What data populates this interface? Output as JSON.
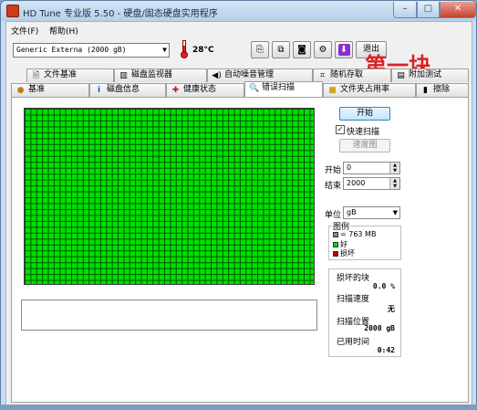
{
  "window": {
    "title": "HD Tune 专业版 5.50 - 硬盘/固态硬盘实用程序"
  },
  "menu": {
    "file": "文件(F)",
    "help": "帮助(H)"
  },
  "toolbar": {
    "drive": "Generic Externa   (2000 gB)",
    "temperature": "28°C",
    "exit_label": "退出"
  },
  "overlay_text": "第一块",
  "tabs_row1": [
    {
      "label": "文件基准",
      "icon": "file-benchmark-icon"
    },
    {
      "label": "磁盘监视器",
      "icon": "disk-monitor-icon"
    },
    {
      "label": "自动噪音管理",
      "icon": "speaker-icon"
    },
    {
      "label": "随机存取",
      "icon": "random-access-icon"
    },
    {
      "label": "附加测试",
      "icon": "extra-tests-icon"
    }
  ],
  "tabs_row2": [
    {
      "label": "基准",
      "icon": "benchmark-icon"
    },
    {
      "label": "磁盘信息",
      "icon": "info-icon"
    },
    {
      "label": "健康状态",
      "icon": "health-icon"
    },
    {
      "label": "错误扫描",
      "icon": "magnifier-icon"
    },
    {
      "label": "文件夹占用率",
      "icon": "folder-icon"
    },
    {
      "label": "擦除",
      "icon": "erase-icon"
    }
  ],
  "scan": {
    "start_button": "开始",
    "quick_scan_label": "快速扫描",
    "quick_scan_checked": true,
    "speed_map_button": "速度图",
    "start_label": "开始",
    "start_value": "0",
    "end_label": "结束",
    "end_value": "2000",
    "unit_label": "单位",
    "unit_value": "gB",
    "legend_title": "图例",
    "legend_block": "= 763 MB",
    "legend_good": "好",
    "legend_bad": "损坏",
    "damaged_blocks_label": "损坏的块",
    "damaged_blocks_value": "0.0 %",
    "scan_speed_label": "扫描速度",
    "scan_speed_value": "无",
    "scan_position_label": "扫描位置",
    "scan_position_value": "2000 gB",
    "elapsed_label": "已用时间",
    "elapsed_value": "0:42",
    "block_status": "all-good"
  },
  "colors": {
    "good": "#00e000",
    "bad": "#c00000",
    "grid_line": "#005500"
  }
}
